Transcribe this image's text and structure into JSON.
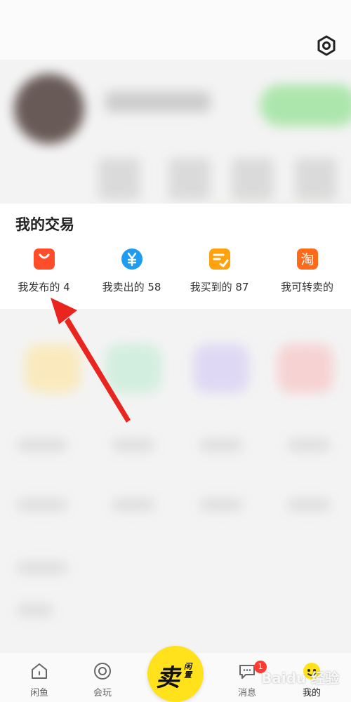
{
  "header": {
    "settings_icon": "settings-hexagon-icon"
  },
  "trade_card": {
    "title": "我的交易",
    "items": [
      {
        "label": "我发布的 4",
        "icon": "shopping-bag-icon",
        "color": "#ff4d2a"
      },
      {
        "label": "我卖出的 58",
        "icon": "yuan-coin-icon",
        "color": "#1e9cf2"
      },
      {
        "label": "我买到的 87",
        "icon": "checked-note-icon",
        "color": "#ffa20d"
      },
      {
        "label": "我可转卖的",
        "icon": "taobao-icon",
        "color": "#ff6a1a",
        "glyph": "淘"
      }
    ]
  },
  "tabbar": {
    "tabs": [
      {
        "label": "闲鱼",
        "icon": "home-icon"
      },
      {
        "label": "会玩",
        "icon": "circle-target-icon"
      },
      {
        "label": "消息",
        "icon": "chat-bubble-icon"
      },
      {
        "label": "我的",
        "icon": "profile-icon"
      }
    ],
    "sell_button": {
      "main": "卖",
      "sub": "闲置"
    },
    "message_badge": "1"
  },
  "watermark": "Baidu 经验",
  "colors": {
    "accent": "#ffe21c",
    "annotation_arrow": "#e8261f"
  }
}
